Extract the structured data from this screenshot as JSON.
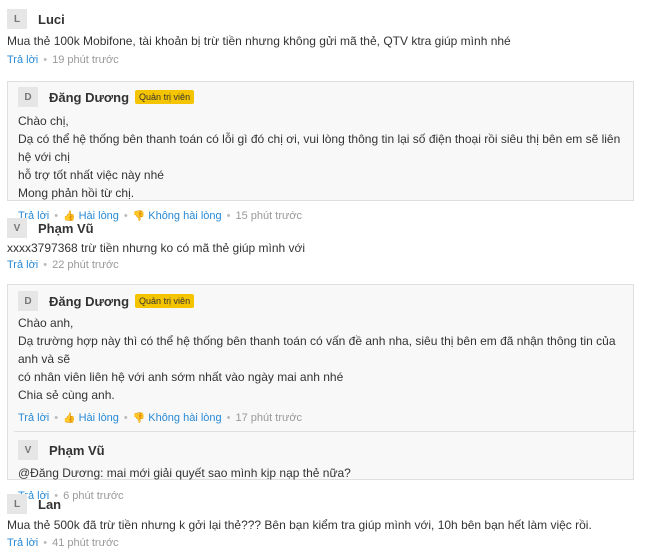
{
  "comments": [
    {
      "initial": "L",
      "name": "Luci",
      "text": "Mua thẻ 100k Mobifone, tài khoản bị trừ tiền nhưng không gửi mã thẻ, QTV ktra giúp mình nhé",
      "reply_label": "Trả lời",
      "time": "19 phút trước",
      "replies": [
        {
          "initial": "D",
          "name": "Đăng Dương",
          "badge": "Quản trị viên",
          "lines": [
            "Chào chị,",
            "Dạ có thể hệ thống bên thanh toán có lỗi gì đó chị ơi, vui lòng thông tin lại số điện thoại rồi siêu thị bên em sẽ liên hệ với chị",
            "hỗ trợ tốt nhất việc này nhé",
            "Mong phản hồi từ chị."
          ],
          "reply_label": "Trả lời",
          "like_label": "Hài lòng",
          "dislike_label": "Không hài lòng",
          "time": "15 phút trước"
        }
      ]
    },
    {
      "initial": "V",
      "name": "Phạm Vũ",
      "text": "xxxx3797368 trừ tiền nhưng ko có mã thẻ giúp mình với",
      "reply_label": "Trả lời",
      "time": "22 phút trước",
      "replies": [
        {
          "initial": "D",
          "name": "Đăng Dương",
          "badge": "Quản trị viên",
          "lines": [
            "Chào anh,",
            "Dạ trường hợp này thì có thể hệ thống bên thanh toán có vấn đề anh nha, siêu thị bên em đã nhận thông tin của anh và sẽ",
            "có nhân viên liên hệ với anh sớm nhất vào ngày mai anh nhé",
            "Chia sẻ cùng anh."
          ],
          "reply_label": "Trả lời",
          "like_label": "Hài lòng",
          "dislike_label": "Không hài lòng",
          "time": "17 phút trước"
        },
        {
          "initial": "V",
          "name": "Phạm Vũ",
          "lines": [
            "@Đăng Dương: mai mới giải quyết sao mình kịp nạp thẻ nữa?"
          ],
          "reply_label": "Trả lời",
          "time": "6 phút trước"
        }
      ]
    },
    {
      "initial": "L",
      "name": "Lan",
      "text": "Mua thẻ 500k đã trừ tiền nhưng k gởi lại thẻ??? Bên bạn kiểm tra giúp mình với, 10h bên bạn hết làm việc rồi.",
      "reply_label": "Trả lời",
      "time": "41 phút trước"
    }
  ]
}
